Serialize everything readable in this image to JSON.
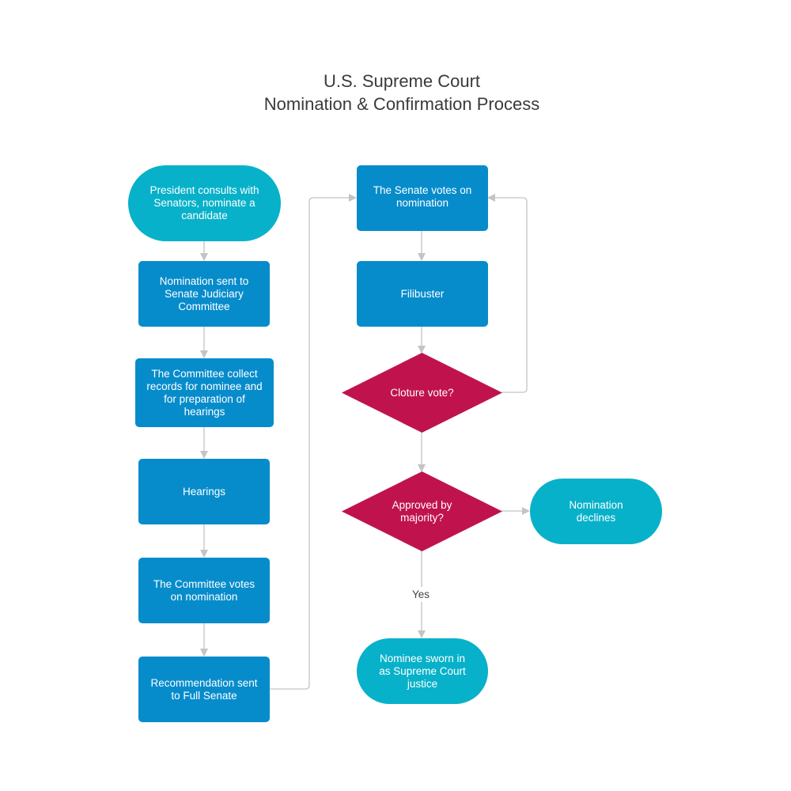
{
  "title": {
    "line1": "U.S. Supreme Court",
    "line2": "Nomination & Confirmation Process"
  },
  "colors": {
    "process": "#078ccb",
    "terminal": "#07b1c9",
    "decision": "#c0134e",
    "connector": "#c4c4c4"
  },
  "nodes": {
    "president": "President consults with Senators, nominate a candidate",
    "sent_committee": "Nomination sent to Senate Judiciary Committee",
    "collect_records": "The Committee collect records for nominee and for preparation of hearings",
    "hearings": "Hearings",
    "committee_votes": "The Committee votes on nomination",
    "recommendation": "Recommendation sent to Full Senate",
    "senate_votes": "The Senate votes on nomination",
    "filibuster": "Filibuster",
    "cloture": "Cloture vote?",
    "approved": "Approved by majority?",
    "declines": "Nomination declines",
    "sworn_in": "Nominee sworn in as Supreme Court justice"
  },
  "edge_labels": {
    "yes": "Yes"
  }
}
